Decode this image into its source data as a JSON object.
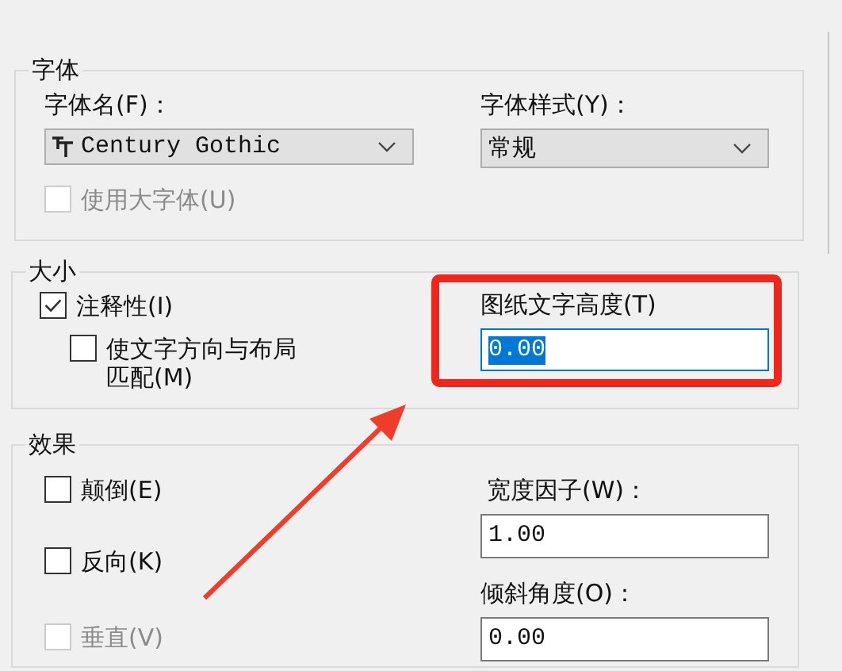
{
  "font_group": {
    "title": "字体",
    "font_name": {
      "label": "字体名(F)：",
      "value": "Century Gothic"
    },
    "font_style": {
      "label": "字体样式(Y)：",
      "value": "常规"
    },
    "use_big_font": {
      "label": "使用大字体(U)",
      "checked": false,
      "disabled": true
    }
  },
  "size_group": {
    "title": "大小",
    "checkboxes": [
      {
        "label": "注释性(I)",
        "checked": true,
        "disabled": false
      },
      {
        "label": "使文字方向与布局匹配(M)",
        "checked": false,
        "disabled": false
      }
    ],
    "paper_height": {
      "label": "图纸文字高度(T)",
      "value": "0.00",
      "selected": true
    }
  },
  "effects_group": {
    "title": "效果",
    "checkboxes": [
      {
        "label": "颠倒(E)",
        "checked": false,
        "disabled": false
      },
      {
        "label": "反向(K)",
        "checked": false,
        "disabled": false
      },
      {
        "label": "垂直(V)",
        "checked": false,
        "disabled": true
      }
    ],
    "width_factor": {
      "label": "宽度因子(W)：",
      "value": "1.00"
    },
    "oblique_angle": {
      "label": "倾斜角度(O)：",
      "value": "0.00"
    }
  }
}
